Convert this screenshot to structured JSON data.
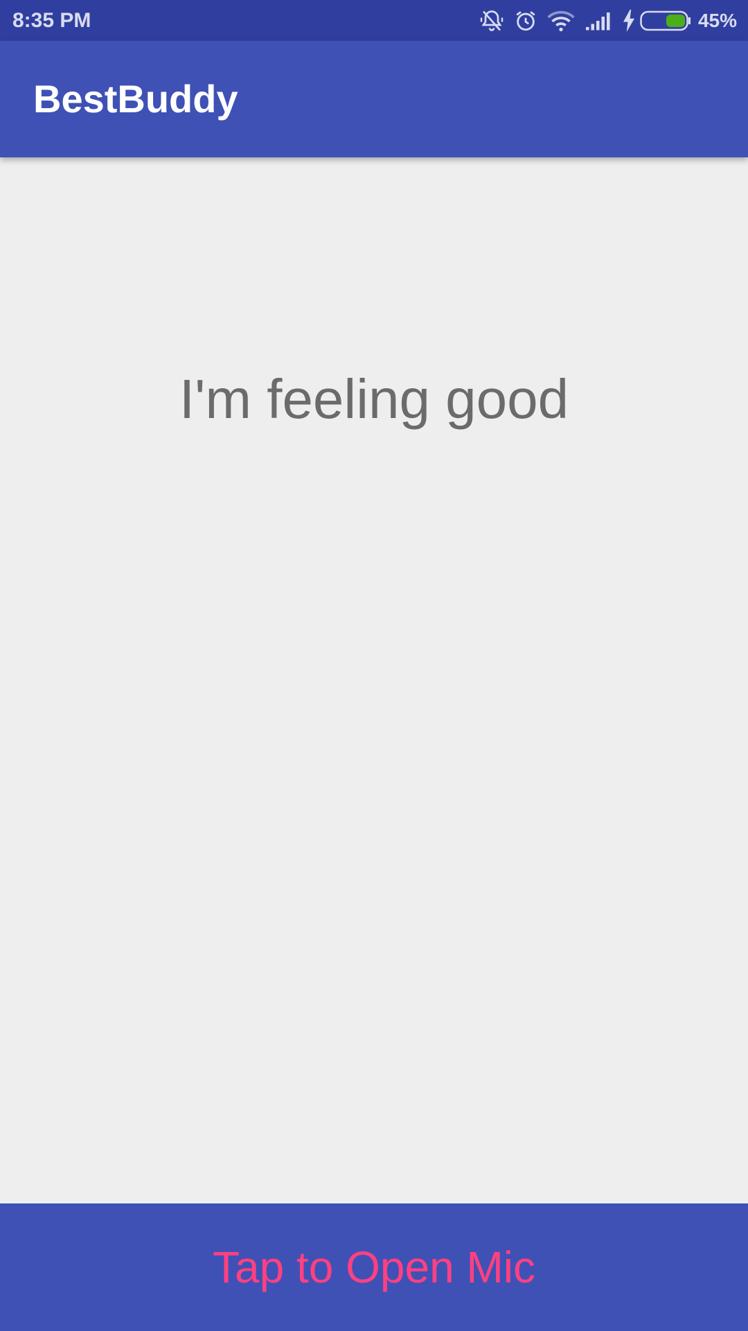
{
  "status_bar": {
    "time": "8:35 PM",
    "battery_percent": "45%",
    "battery_level": 0.45,
    "icons": [
      "notifications-off-icon",
      "alarm-icon",
      "wifi-icon",
      "signal-icon",
      "charging-icon",
      "battery-icon"
    ]
  },
  "app_bar": {
    "title": "BestBuddy"
  },
  "main": {
    "message": "I'm feeling good"
  },
  "bottom_bar": {
    "label": "Tap to Open Mic"
  },
  "colors": {
    "primary": "#3f51b5",
    "primary_dark": "#303f9f",
    "accent": "#ff4081",
    "background": "#eeeeee",
    "message_text": "#6b6b6b",
    "battery_fill": "#4caf1a"
  }
}
